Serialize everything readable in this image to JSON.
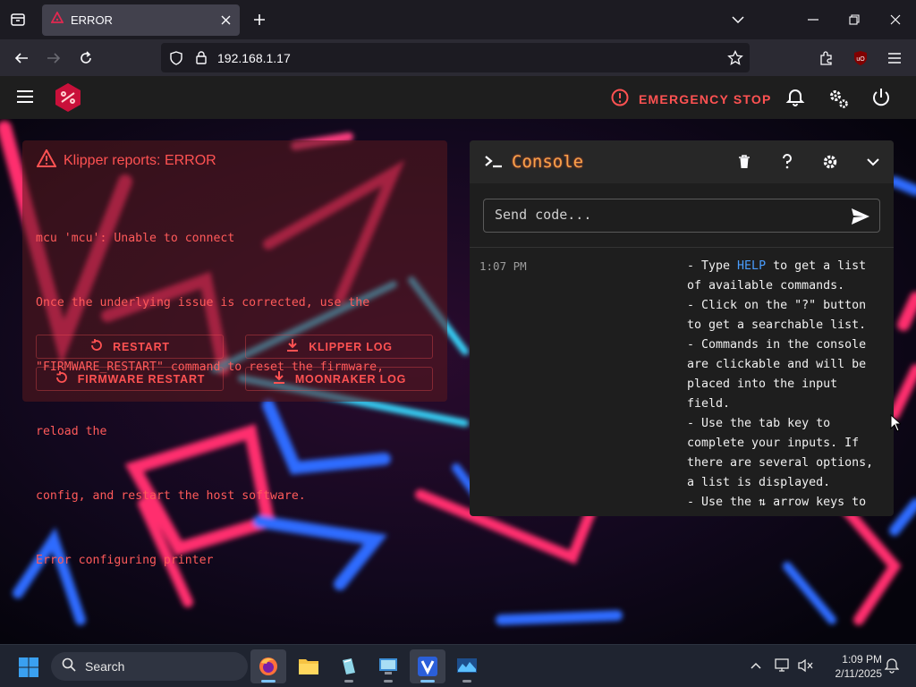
{
  "browser": {
    "tab_title": "ERROR",
    "url": "192.168.1.17"
  },
  "app": {
    "emergency_stop_label": "EMERGENCY STOP",
    "accent_color": "#ff5252"
  },
  "error_panel": {
    "title": "Klipper reports: ERROR",
    "message_lines": [
      "mcu 'mcu': Unable to connect",
      "Once the underlying issue is corrected, use the",
      "\"FIRMWARE_RESTART\" command to reset the firmware,",
      "reload the",
      "config, and restart the host software.",
      "Error configuring printer"
    ],
    "buttons": {
      "restart": "RESTART",
      "klipper_log": "KLIPPER LOG",
      "firmware_restart": "FIRMWARE RESTART",
      "moonraker_log": "MOONRAKER LOG"
    }
  },
  "console": {
    "title": "Console",
    "input_placeholder": "Send code...",
    "entry_time": "1:07 PM",
    "entry_parts": {
      "line1_pre": "- Type ",
      "help_word": "HELP",
      "line1_post": " to get a list of available commands.",
      "rest": "- Click on the \"?\" button to get a searchable list.\n- Commands in the console are clickable and will be placed into the input field.\n- Use the tab key to complete your inputs. If there are several options, a list is displayed.\n- Use the ⇅ arrow keys to"
    }
  },
  "taskbar": {
    "search_label": "Search",
    "time": "1:09 PM",
    "date": "2/11/2025"
  }
}
